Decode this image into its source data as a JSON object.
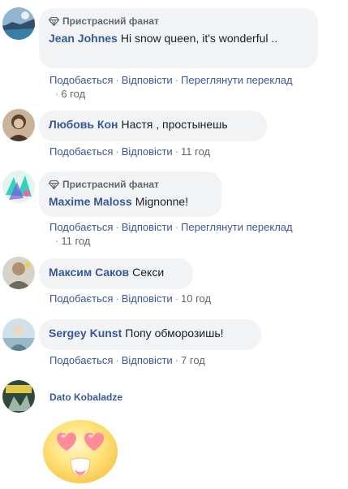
{
  "comments": [
    {
      "badge": "Пристрасний фанат",
      "author": "Jean Johnes",
      "text": "Hi snow queen, it's wonderful ..",
      "like": "Подобається",
      "reply": "Відповісти",
      "translate": "Переглянути переклад",
      "time": "6 год"
    },
    {
      "author": "Любовь Кон",
      "text": "Настя , простынешь",
      "like": "Подобається",
      "reply": "Відповісти",
      "time": "11 год"
    },
    {
      "badge": "Пристрасний фанат",
      "author": "Maxime Maloss",
      "text": "Mignonne!",
      "like": "Подобається",
      "reply": "Відповісти",
      "translate": "Переглянути переклад",
      "time": "11 год"
    },
    {
      "author": "Максим Саков",
      "text": "Секси",
      "like": "Подобається",
      "reply": "Відповісти",
      "time": "10 год"
    },
    {
      "author": "Sergey Kunst",
      "text": "Попу обморозишь!",
      "like": "Подобається",
      "reply": "Відповісти",
      "time": "7 год"
    },
    {
      "author": "Dato Kobaladze",
      "sticker": "heart-eyes-emoji"
    }
  ],
  "separator": "·",
  "colors": {
    "link": "#385898",
    "bubble": "#f2f3f5",
    "meta": "#606770"
  }
}
